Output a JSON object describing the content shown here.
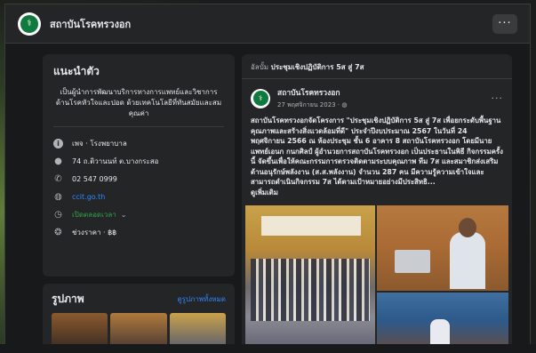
{
  "header": {
    "page_name": "สถาบันโรคทรวงอก",
    "more_label": "···"
  },
  "intro": {
    "title": "แนะนำตัว",
    "description": "เป็นผู้นำการพัฒนาบริการทางการแพทย์และวิชาการด้านโรคหัวใจและปอด ด้วยเทคโนโลยีที่ทันสมัยและสมคุณค่า",
    "rows": [
      {
        "icon": "info-icon",
        "text": "เพจ · โรงพยาบาล"
      },
      {
        "icon": "location-pin-icon",
        "text": "74 ถ.ติวานนท์ ต.บางกระสอ"
      },
      {
        "icon": "phone-icon",
        "text": "02 547 0999"
      },
      {
        "icon": "globe-icon",
        "text": "ccit.go.th"
      },
      {
        "icon": "clock-icon",
        "text": "เปิดตลอดเวลา"
      },
      {
        "icon": "price-icon",
        "text": "ช่วงราคา · ฿฿"
      }
    ]
  },
  "photos": {
    "title": "รูปภาพ",
    "see_all": "ดูรูปภาพทั้งหมด"
  },
  "post": {
    "context_prefix": "อัลบั้ม",
    "context_title": "ประชุมเชิงปฏิบัติการ 5ส สู่ 7ส",
    "author": "สถาบันโรคทรวงอก",
    "date": "27 พฤศจิกายน 2023 · ",
    "body": "สถาบันโรคทรวงอกจัดโครงการ \"ประชุมเชิงปฏิบัติการ 5ส สู่ 7ส เพื่อยกระดับพื้นฐานคุณภาพและสร้างสิ่งแวดล้อมที่ดี\" ประจำปีงบประมาณ 2567 ในวันที่ 24 พฤศจิกายน 2566 ณ ห้องประชุม ชั้น 6 อาคาร 8 สถาบันโรคทรวงอก โดยมีนายแพทย์เอนก กนกศิลป์ ผู้อำนวยการสถาบันโรคทรวงอก เป็นประธานในพิธี กิจกรรมครั้งนี้ จัดขึ้นเพื่อให้คณะกรรมการตรวจติดตามระบบคุณภาพ ทีม 7ส และสมาชิกส่งเสริมด้านอนุรักษ์พลังงาน (ส.ส.พลังงาน) จำนวน 287 คน มีความรู้ความเข้าใจและสามารถดำเนินกิจกรรม 7ส ได้ตามเป้าหมายอย่างมีประสิทธิ...",
    "see_more": "ดูเพิ่มเติม",
    "more_label": "···"
  },
  "colors": {
    "accent_link": "#2d88ff",
    "open_green": "#31a24c",
    "logo_green": "#0f7a3d"
  }
}
